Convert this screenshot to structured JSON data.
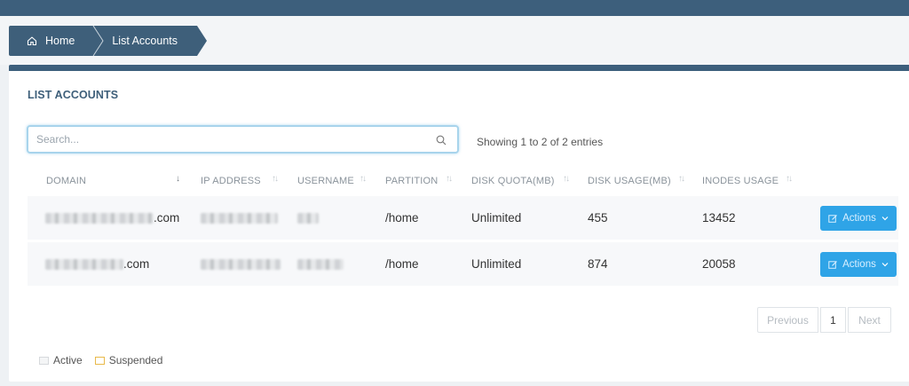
{
  "breadcrumb": {
    "home": "Home",
    "current": "List Accounts"
  },
  "panel": {
    "title": "LIST ACCOUNTS"
  },
  "search": {
    "placeholder": "Search...",
    "value": ""
  },
  "showing": "Showing 1 to 2 of 2 entries",
  "columns": [
    "DOMAIN",
    "IP ADDRESS",
    "USERNAME",
    "PARTITION",
    "DISK QUOTA(MB)",
    "DISK USAGE(MB)",
    "INODES USAGE"
  ],
  "rows": [
    {
      "domain_suffix": ".com",
      "partition": "/home",
      "disk_quota": "Unlimited",
      "disk_usage": "455",
      "inodes_usage": "13452",
      "actions_label": "Actions"
    },
    {
      "domain_suffix": ".com",
      "partition": "/home",
      "disk_quota": "Unlimited",
      "disk_usage": "874",
      "inodes_usage": "20058",
      "actions_label": "Actions"
    }
  ],
  "pagination": {
    "previous": "Previous",
    "current_page": "1",
    "next": "Next"
  },
  "legend": [
    {
      "label": "Active",
      "color": "#d6d9dc"
    },
    {
      "label": "Suspended",
      "color": "#e8b94a"
    }
  ],
  "colors": {
    "header": "#3d5f7c",
    "accent": "#2fa4e7"
  },
  "icons": {
    "home": "home-icon",
    "search": "search-icon",
    "edit": "edit-icon",
    "caret": "chevron-down-icon"
  }
}
